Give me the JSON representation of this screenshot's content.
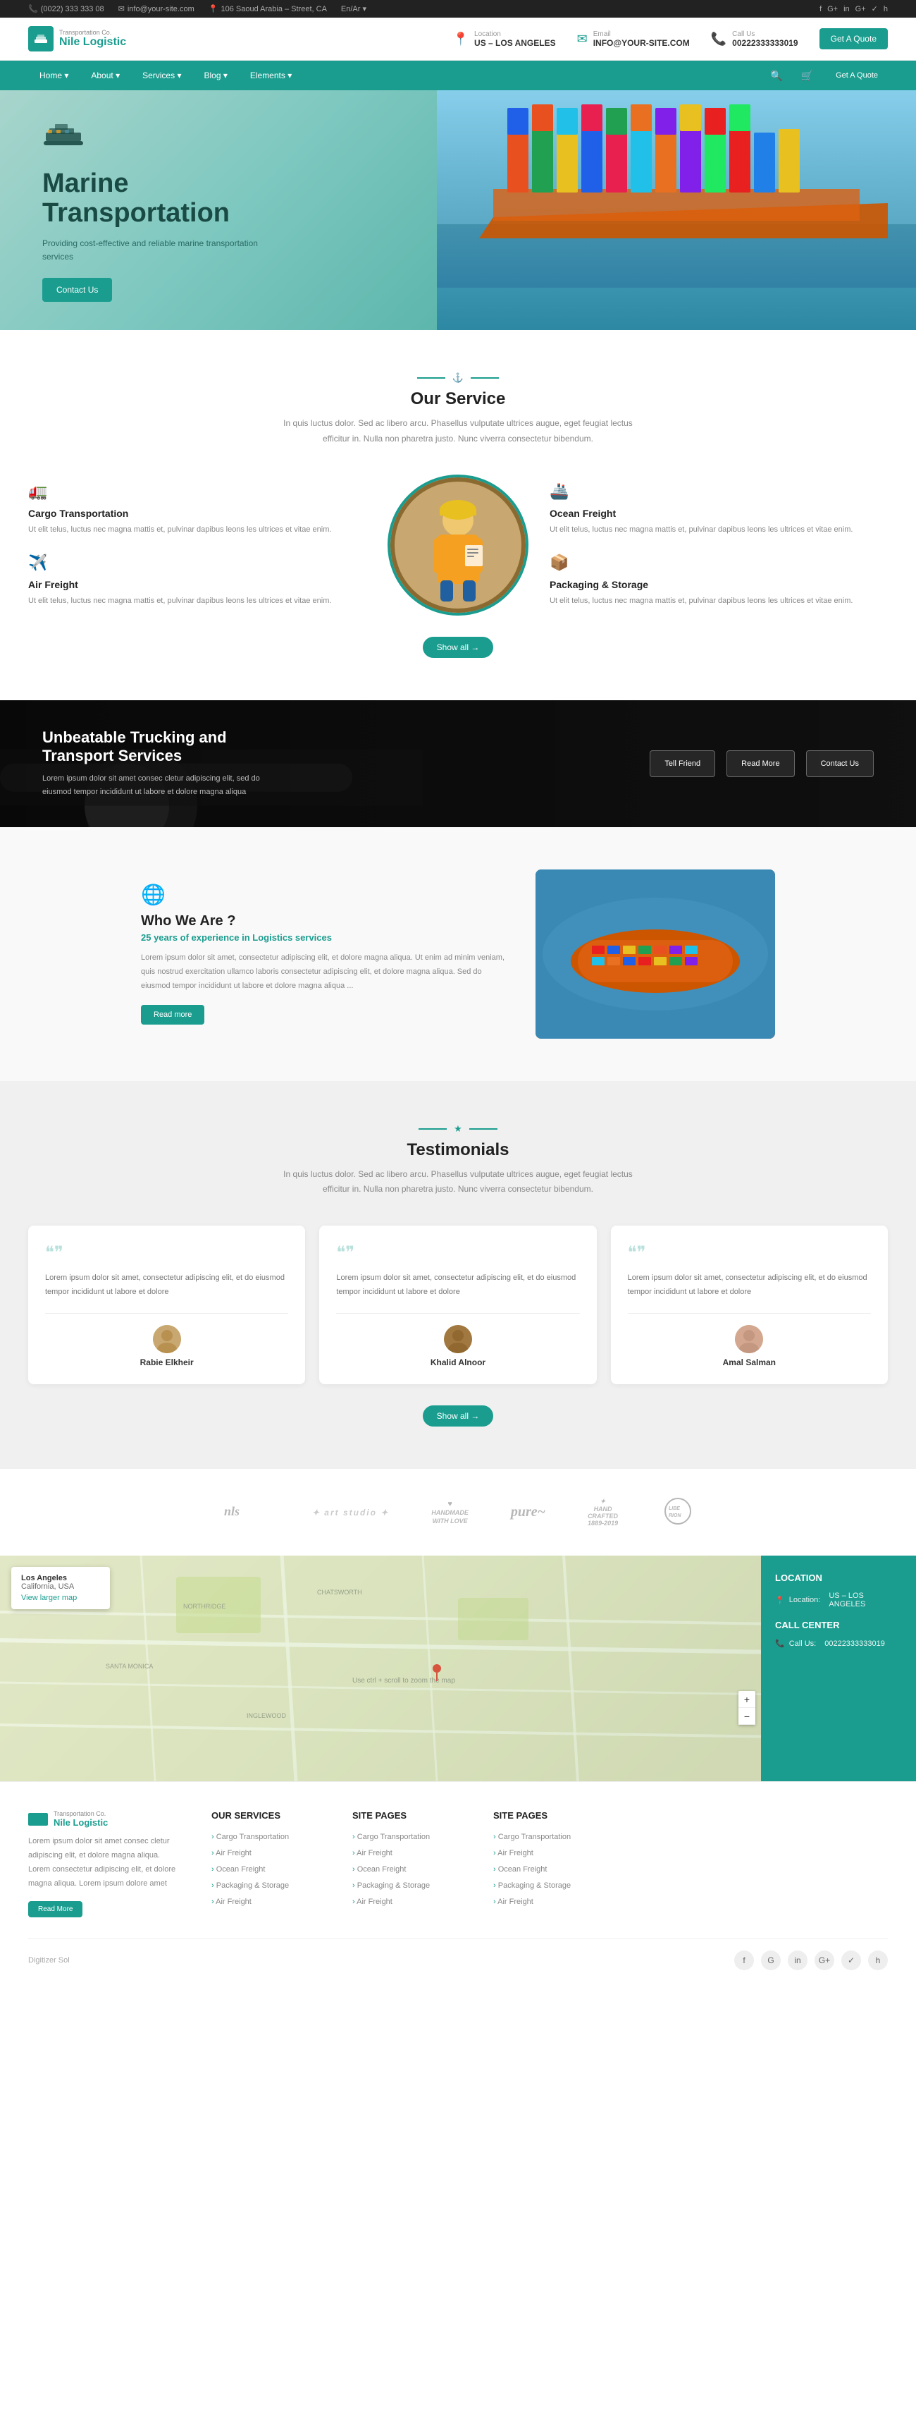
{
  "topbar": {
    "phone": "(0022) 333 333 08",
    "email": "info@your-site.com",
    "address": "106 Saoud Arabia – Street, CA",
    "jobs": "En/Ar ▾",
    "social": [
      "f",
      "G+",
      "in",
      "G+",
      "✓",
      "h"
    ]
  },
  "header": {
    "logo_text": "Nile Logistic",
    "location_label": "Location",
    "location_value": "US – LOS ANGELES",
    "email_label": "Email",
    "email_value": "INFO@YOUR-SITE.COM",
    "phone_label": "Call Us",
    "phone_value": "00222333333019",
    "cta_button": "Get A Quote"
  },
  "nav": {
    "items": [
      "Home ▾",
      "About ▾",
      "Services ▾",
      "Blog ▾",
      "Elements ▾"
    ],
    "cta": "Get A Quote"
  },
  "hero": {
    "title": "Marine Transportation",
    "subtitle": "Providing cost-effective and reliable marine transportation services",
    "cta_button": "Contact Us"
  },
  "services": {
    "section_label": "Our Service",
    "subtitle": "In quis luctus dolor. Sed ac libero arcu. Phasellus vulputate ultrices augue, eget feugiat lectus efficitur in. Nulla non pharetra justo. Nunc viverra consectetur bibendum.",
    "items": [
      {
        "icon": "🚛",
        "name": "Cargo Transportation",
        "desc": "Ut elit telus, luctus nec magna mattis et, pulvinar dapibus leons les ultrices et vitae enim.",
        "side": "left"
      },
      {
        "icon": "🚢",
        "name": "Ocean Freight",
        "desc": "Ut elit telus, luctus nec magna mattis et, pulvinar dapibus leons les ultrices et vitae enim.",
        "side": "right"
      },
      {
        "icon": "✈️",
        "name": "Air Freight",
        "desc": "Ut elit telus, luctus nec magna mattis et, pulvinar dapibus leons les ultrices et vitae enim.",
        "side": "left"
      },
      {
        "icon": "📦",
        "name": "Packaging & Storage",
        "desc": "Ut elit telus, luctus nec magna mattis et, pulvinar dapibus leons les ultrices et vitae enim.",
        "side": "right"
      }
    ],
    "show_all": "Show all →"
  },
  "trucking": {
    "title": "Unbeatable Trucking and Transport Services",
    "desc": "Lorem ipsum dolor sit amet consec cletur adipiscing elit, sed do eiusmod tempor incididunt ut labore et dolore magna aliqua",
    "buttons": [
      "Tell Friend",
      "Read More",
      "Contact Us"
    ]
  },
  "who": {
    "title": "Who We Are ?",
    "subtitle": "25 years of experience in Logistics services",
    "desc": "Lorem ipsum dolor sit amet, consectetur adipiscing elit, et dolore magna aliqua. Ut enim ad minim veniam, quis nostrud exercitation ullamco laboris consectetur adipiscing elit, et dolore magna aliqua. Sed do eiusmod tempor incididunt ut labore et dolore magna aliqua ...",
    "read_more": "Read more"
  },
  "testimonials": {
    "title": "Testimonials",
    "subtitle": "In quis luctus dolor. Sed ac libero arcu. Phasellus vulputate ultrices augue, eget feugiat lectus efficitur in. Nulla non pharetra justo. Nunc viverra consectetur bibendum.",
    "items": [
      {
        "text": "Lorem ipsum dolor sit amet, consectetur adipiscing elit, et do eiusmod tempor incididunt ut labore et dolore",
        "name": "Rabie Elkheir",
        "avatar": "👨"
      },
      {
        "text": "Lorem ipsum dolor sit amet, consectetur adipiscing elit, et do eiusmod tempor incididunt ut labore et dolore",
        "name": "Khalid Alnoor",
        "avatar": "👨"
      },
      {
        "text": "Lorem ipsum dolor sit amet, consectetur adipiscing elit, et do eiusmod tempor incididunt ut labore et dolore",
        "name": "Amal Salman",
        "avatar": "👩"
      }
    ],
    "show_all": "Show all →"
  },
  "brands": [
    "nls",
    "art studio",
    "HANDMADE WITH LOVE",
    "pure",
    "HAND CRAFTED",
    "LIBERION"
  ],
  "map": {
    "location_city": "Los Angeles",
    "location_state": "California, USA",
    "view_larger": "View larger map",
    "ctrl_scroll": "Use ctrl + scroll to zoom the map",
    "location_label": "LOCATION",
    "location_detail_label": "Location:",
    "location_detail_value": "US – LOS ANGELES",
    "call_center_label": "CALL CENTER",
    "call_label": "Call Us:",
    "call_value": "00222333333019"
  },
  "footer": {
    "logo": "Nile Logistic",
    "tagline": "Transportation Co.",
    "desc": "Lorem ipsum dolor sit amet consec cletur adipiscing elit, et dolore magna aliqua. Lorem consectetur adipiscing elit, et dolore magna aliqua. Lorem ipsum dolore amet",
    "read_more": "Read More",
    "services_title": "OUR SERVICES",
    "services_links": [
      "Cargo Transportation",
      "Air Freight",
      "Ocean Freight",
      "Packaging & Storage",
      "Air Freight"
    ],
    "site_pages_title": "SITE PAGES",
    "site_pages_links": [
      "Cargo Transportation",
      "Air Freight",
      "Ocean Freight",
      "Packaging & Storage",
      "Air Freight"
    ],
    "site_pages2_title": "SITE PAGES",
    "site_pages2_links": [
      "Cargo Transportation",
      "Air Freight",
      "Ocean Freight",
      "Packaging & Storage",
      "Air Freight"
    ],
    "credit": "Digitizer Sol",
    "social": [
      "f",
      "G",
      "in",
      "G+",
      "✓",
      "h"
    ]
  }
}
